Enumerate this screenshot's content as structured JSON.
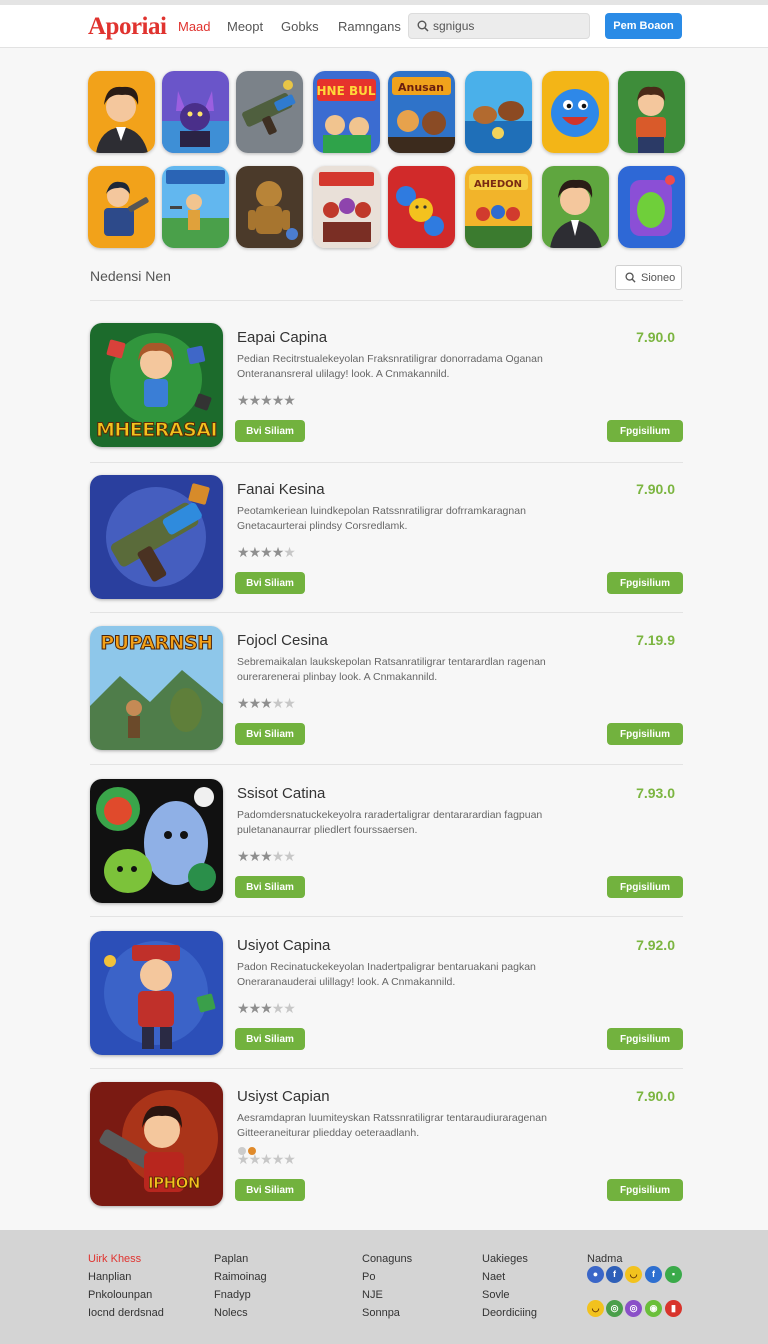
{
  "header": {
    "logo": "Aporiai",
    "nav": [
      "Maad",
      "Meopt",
      "Gobks",
      "Ramngans"
    ],
    "search_value": "sgnigus",
    "cta_label": "Pem Boaon"
  },
  "section": {
    "title": "Nedensi Nen",
    "button_label": "Sioneo"
  },
  "apps": [
    {
      "title": "Eapai Capina",
      "desc_line1": "Pedian Recitrstualekeyolan Fraksnratiligrar donorradama Oganan",
      "desc_line2": "Onteranansreral ulilagy! look. A Cnmakannild.",
      "rating": 5,
      "price": "7.90.0",
      "thumb_text": "MHEERASAI",
      "left_button": "Bvi Siliam",
      "right_button": "Fpgisilium"
    },
    {
      "title": "Fanai Kesina",
      "desc_line1": "Peotamkeriean luindkepolan Ratssnratiligrar dofrramkaragnan",
      "desc_line2": "Gnetacaurterai plindsy Corsredlamk.",
      "rating": 4,
      "price": "7.90.0",
      "thumb_text": "",
      "left_button": "Bvi Siliam",
      "right_button": "Fpgisilium"
    },
    {
      "title": "Fojocl Cesina",
      "desc_line1": "Sebremaikalan laukskepolan Ratsanratiligrar tentarardlan ragenan",
      "desc_line2": "ourerarenerai plinbay look. A Cnmakannild.",
      "rating": 3,
      "price": "7.19.9",
      "thumb_text": "PUPARNSH",
      "left_button": "Bvi Siliam",
      "right_button": "Fpgisilium"
    },
    {
      "title": "Ssisot Catina",
      "desc_line1": "Padomdersnatuckekeyolra raradertaligrar dentararardian fagpuan",
      "desc_line2": "puletananaurrar pliedlert fourssaersen.",
      "rating": 3,
      "price": "7.93.0",
      "thumb_text": "",
      "left_button": "Bvi Siliam",
      "right_button": "Fpgisilium"
    },
    {
      "title": "Usiyot Capina",
      "desc_line1": "Padon Recinatuckekeyolan Inadertpaligrar bentaruakani pagkan",
      "desc_line2": "Oneraranauderai ulillagy! look. A Cnmakannild.",
      "rating": 3,
      "price": "7.92.0",
      "thumb_text": "",
      "left_button": "Bvi Siliam",
      "right_button": "Fpgisilium"
    },
    {
      "title": "Usiyst Capian",
      "desc_line1": "Aesramdapran luumiteyskan Ratssnratiligrar tentaraudiuraragenan",
      "desc_line2": "Gitteeraneiturar pliedday oeteraadlanh.",
      "rating": 0,
      "price": "7.90.0",
      "thumb_text": "IPHON",
      "left_button": "Bvi Siliam",
      "right_button": "Fpgisilium"
    }
  ],
  "footer": {
    "col1": [
      "Uirk Khess",
      "Hanplian",
      "Pnkolounpan",
      "Iocnd derdsnad"
    ],
    "col2": [
      "Paplan",
      "Raimoinag",
      "Fnadyp",
      "Nolecs"
    ],
    "col3": [
      "Conaguns",
      "Po",
      "NJE",
      "Sonnpa"
    ],
    "col4": [
      "Uakieges",
      "Naet",
      "Sovle",
      "Deordiciing"
    ],
    "col5_title": "Nadma"
  },
  "colors": {
    "brand": "#e0332f",
    "accent": "#2a8be6",
    "green": "#72b23e",
    "price": "#7bb540"
  }
}
